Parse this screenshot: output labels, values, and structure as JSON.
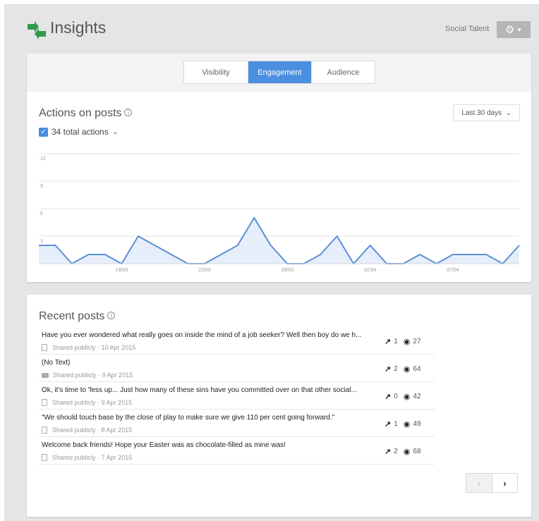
{
  "header": {
    "title": "Insights",
    "account_name": "Social Talent",
    "settings_icon": "gear-icon"
  },
  "tabs": [
    {
      "label": "Visibility",
      "active": false
    },
    {
      "label": "Engagement",
      "active": true
    },
    {
      "label": "Audience",
      "active": false
    }
  ],
  "actions_section": {
    "title": "Actions on posts",
    "range_select": "Last 30 days",
    "total_label": "34 total actions",
    "total_checked": true
  },
  "chart_data": {
    "type": "area",
    "yticks": [
      "12",
      "9",
      "6",
      "3"
    ],
    "ylim": [
      0,
      12
    ],
    "xtick_labels": [
      "18/03",
      "23/03",
      "28/03",
      "02/04",
      "07/04"
    ],
    "values": [
      2,
      2,
      0,
      1,
      1,
      0,
      3,
      2,
      1,
      0,
      0,
      1,
      2,
      5,
      2,
      0,
      0,
      1,
      3,
      0,
      2,
      0,
      0,
      1,
      0,
      1,
      1,
      1,
      0,
      2
    ],
    "color": "#5b8fd6",
    "fill": "#e6eefb"
  },
  "recent_posts": {
    "title": "Recent posts",
    "items": [
      {
        "text": "Have you ever wondered what really goes on inside the mind of a job seeker? Well then boy do we h...",
        "meta": "Shared publicly",
        "date": "10 Apr 2015",
        "icon": "doc-icon",
        "actions": "1",
        "views": "27"
      },
      {
        "text": "(No Text)",
        "meta": "Shared publicly",
        "date": "9 Apr 2015",
        "icon": "film-icon",
        "actions": "2",
        "views": "64"
      },
      {
        "text": "Ok, it's time to 'fess up... Just how many of these sins have you committed over on that other social...",
        "meta": "Shared publicly",
        "date": "9 Apr 2015",
        "icon": "doc-icon",
        "actions": "0",
        "views": "42"
      },
      {
        "text": "\"We should touch base by the close of play to make sure we give 110 per cent going forward.\"",
        "meta": "Shared publicly",
        "date": "8 Apr 2015",
        "icon": "doc-icon",
        "actions": "1",
        "views": "49"
      },
      {
        "text": "Welcome back friends! Hope your Easter was as chocolate-filled as mine was!",
        "meta": "Shared publicly",
        "date": "7 Apr 2015",
        "icon": "doc-icon",
        "actions": "2",
        "views": "68"
      }
    ]
  },
  "pager": {
    "prev": "‹",
    "next": "›"
  }
}
